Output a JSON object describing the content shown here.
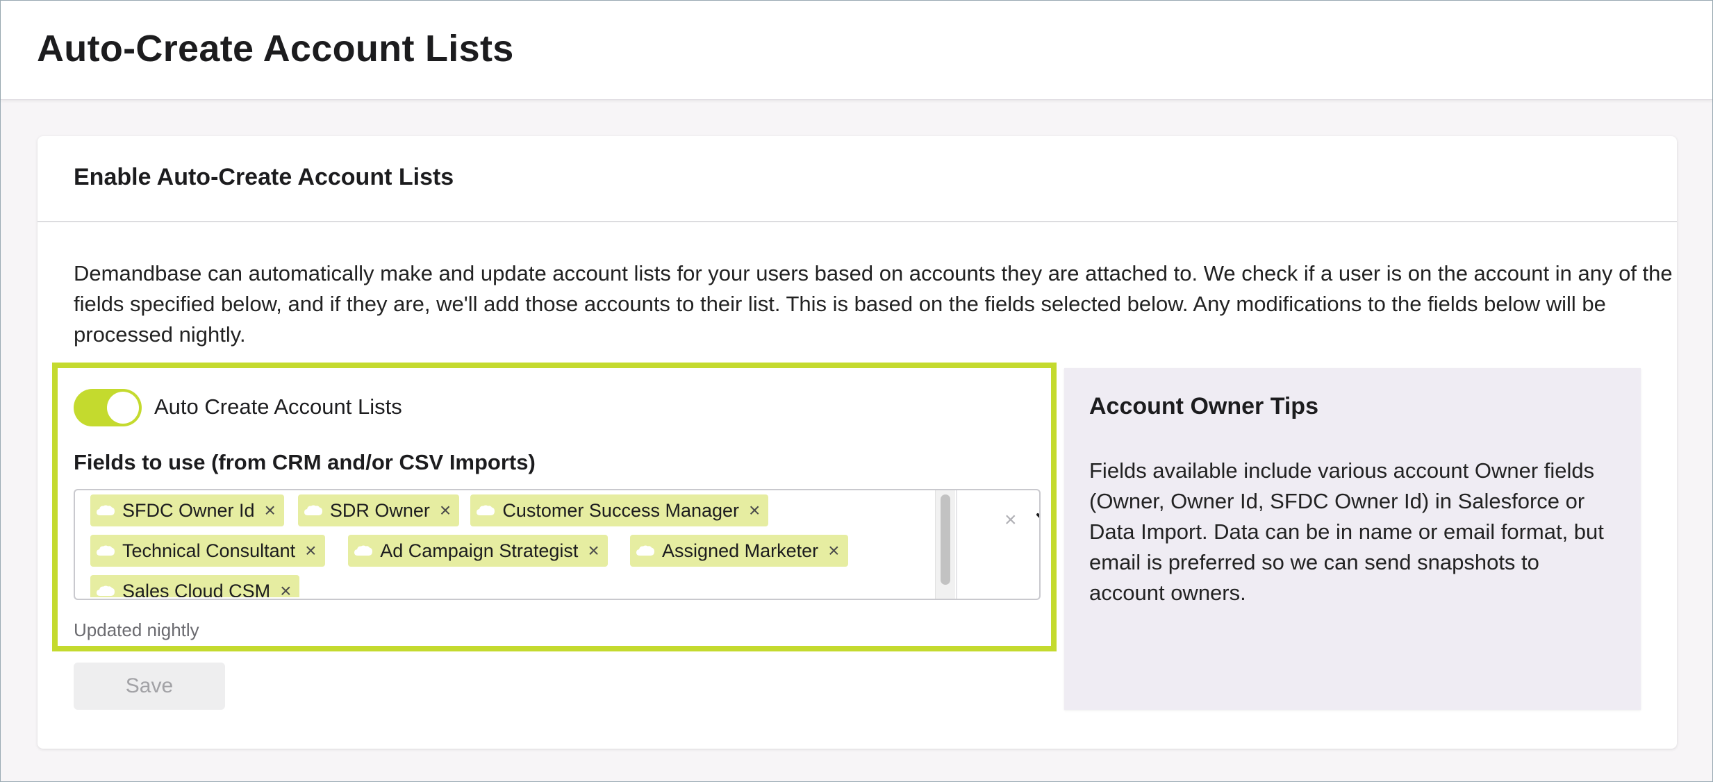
{
  "page": {
    "title": "Auto-Create Account Lists"
  },
  "card": {
    "title": "Enable Auto-Create Account Lists",
    "description": "Demandbase can automatically make and update account lists for your users based on accounts they are attached to. We check if a user is on the account in any of the fields specified below, and if they are, we'll add those accounts to their list. This is based on the fields selected below. Any modifications to the fields below will be processed nightly."
  },
  "toggle": {
    "label": "Auto Create Account Lists",
    "on": true
  },
  "fields": {
    "label": "Fields to use (from CRM and/or CSV Imports)",
    "chips": [
      "SFDC Owner Id",
      "SDR Owner",
      "Customer Success Manager",
      "Technical Consultant",
      "Ad Campaign Strategist",
      "Assigned Marketer",
      "Sales Cloud CSM"
    ],
    "chip_icon": "salesforce-cloud-icon",
    "remove_glyph": "×",
    "clear_glyph": "×",
    "helper": "Updated nightly"
  },
  "save_label": "Save",
  "tips": {
    "title": "Account Owner Tips",
    "body": "Fields available include various account Owner fields (Owner, Owner Id, SFDC Owner Id) in Salesforce or Data Import. Data can be in name or email format, but email is preferred so we can send snapshots to account owners."
  },
  "colors": {
    "accent": "#c4da2e",
    "chip_bg": "#e6eda1",
    "tips_bg": "#efecf3"
  }
}
